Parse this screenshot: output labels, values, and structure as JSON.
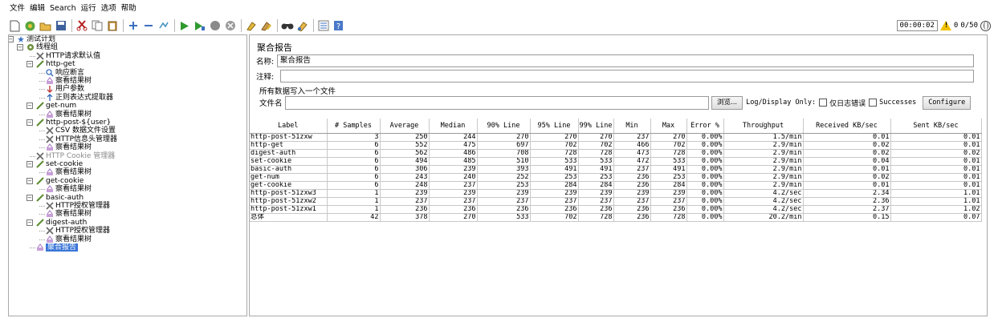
{
  "menu": [
    "文件",
    "编辑",
    "Search",
    "运行",
    "选项",
    "帮助"
  ],
  "toolbar_icons": [
    "new-icon",
    "templates-icon",
    "open-icon",
    "save-icon",
    "cut-icon",
    "copy-icon",
    "paste-icon",
    "expand-icon",
    "collapse-icon",
    "toggle-icon",
    "start-icon",
    "start-no-pause-icon",
    "stop-icon",
    "shutdown-icon",
    "clear-icon",
    "clear-all-icon",
    "search-icon",
    "reset-search-icon",
    "function-helper-icon",
    "help-icon"
  ],
  "status": {
    "timer": "00:00:02",
    "warnings": "0",
    "threads": "0/50"
  },
  "tree": [
    {
      "label": "测试计划",
      "icon": "test-plan-icon"
    },
    {
      "label": "线程组",
      "icon": "thread-group-icon"
    },
    {
      "label": "HTTP请求默认值",
      "icon": "config-icon"
    },
    {
      "label": "http-get",
      "icon": "sampler-icon"
    },
    {
      "label": "响应断言",
      "icon": "assertion-icon"
    },
    {
      "label": "察看结果树",
      "icon": "listener-icon"
    },
    {
      "label": "用户参数",
      "icon": "preprocessor-icon"
    },
    {
      "label": "正则表达式提取器",
      "icon": "postprocessor-icon"
    },
    {
      "label": "get-num",
      "icon": "sampler-icon"
    },
    {
      "label": "察看结果树",
      "icon": "listener-icon"
    },
    {
      "label": "http-post-${user}",
      "icon": "sampler-icon"
    },
    {
      "label": "CSV 数据文件设置",
      "icon": "config-icon"
    },
    {
      "label": "HTTP信息头管理器",
      "icon": "config-icon"
    },
    {
      "label": "察看结果树",
      "icon": "listener-icon"
    },
    {
      "label": "HTTP Cookie 管理器",
      "icon": "config-icon"
    },
    {
      "label": "set-cookie",
      "icon": "sampler-icon"
    },
    {
      "label": "察看结果树",
      "icon": "listener-icon"
    },
    {
      "label": "get-cookie",
      "icon": "sampler-icon"
    },
    {
      "label": "察看结果树",
      "icon": "listener-icon"
    },
    {
      "label": "basic-auth",
      "icon": "sampler-icon"
    },
    {
      "label": "HTTP授权管理器",
      "icon": "config-icon"
    },
    {
      "label": "察看结果树",
      "icon": "listener-icon"
    },
    {
      "label": "digest-auth",
      "icon": "sampler-icon"
    },
    {
      "label": "HTTP授权管理器",
      "icon": "config-icon"
    },
    {
      "label": "察看结果树",
      "icon": "listener-icon"
    },
    {
      "label": "聚合报告",
      "icon": "listener-icon"
    }
  ],
  "panel": {
    "title": "聚合报告",
    "name_label": "名称:",
    "name_value": "聚合报告",
    "comment_label": "注释:",
    "comment_value": "",
    "file_legend": "所有数据写入一个文件",
    "filename_label": "文件名",
    "filename_value": "",
    "browse_label": "浏览...",
    "log_display_label": "Log/Display Only:",
    "errors_only_label": "仅日志错误",
    "successes_label": "Successes",
    "configure_label": "Configure"
  },
  "table": {
    "headers": [
      "Label",
      "# Samples",
      "Average",
      "Median",
      "90% Line",
      "95% Line",
      "99% Line",
      "Min",
      "Max",
      "Error %",
      "Throughput",
      "Received KB/sec",
      "Sent KB/sec"
    ],
    "rows": [
      [
        "http-post-51zxw",
        "3",
        "250",
        "244",
        "270",
        "270",
        "270",
        "237",
        "270",
        "0.00%",
        "1.5/min",
        "0.01",
        "0.01"
      ],
      [
        "http-get",
        "6",
        "552",
        "475",
        "697",
        "702",
        "702",
        "466",
        "702",
        "0.00%",
        "2.9/min",
        "0.02",
        "0.01"
      ],
      [
        "digest-auth",
        "6",
        "562",
        "486",
        "708",
        "728",
        "728",
        "473",
        "728",
        "0.00%",
        "2.9/min",
        "0.02",
        "0.02"
      ],
      [
        "set-cookie",
        "6",
        "494",
        "485",
        "510",
        "533",
        "533",
        "472",
        "533",
        "0.00%",
        "2.9/min",
        "0.04",
        "0.01"
      ],
      [
        "basic-auth",
        "6",
        "306",
        "239",
        "393",
        "491",
        "491",
        "237",
        "491",
        "0.00%",
        "2.9/min",
        "0.01",
        "0.01"
      ],
      [
        "get-num",
        "6",
        "243",
        "240",
        "252",
        "253",
        "253",
        "236",
        "253",
        "0.00%",
        "2.9/min",
        "0.02",
        "0.01"
      ],
      [
        "get-cookie",
        "6",
        "248",
        "237",
        "253",
        "284",
        "284",
        "236",
        "284",
        "0.00%",
        "2.9/min",
        "0.01",
        "0.01"
      ],
      [
        "http-post-51zxw3",
        "1",
        "239",
        "239",
        "239",
        "239",
        "239",
        "239",
        "239",
        "0.00%",
        "4.2/sec",
        "2.34",
        "1.01"
      ],
      [
        "http-post-51zxw2",
        "1",
        "237",
        "237",
        "237",
        "237",
        "237",
        "237",
        "237",
        "0.00%",
        "4.2/sec",
        "2.36",
        "1.01"
      ],
      [
        "http-post-51zxw1",
        "1",
        "236",
        "236",
        "236",
        "236",
        "236",
        "236",
        "236",
        "0.00%",
        "4.2/sec",
        "2.37",
        "1.02"
      ],
      [
        "总体",
        "42",
        "378",
        "270",
        "533",
        "702",
        "728",
        "236",
        "728",
        "0.00%",
        "20.2/min",
        "0.15",
        "0.07"
      ]
    ]
  }
}
